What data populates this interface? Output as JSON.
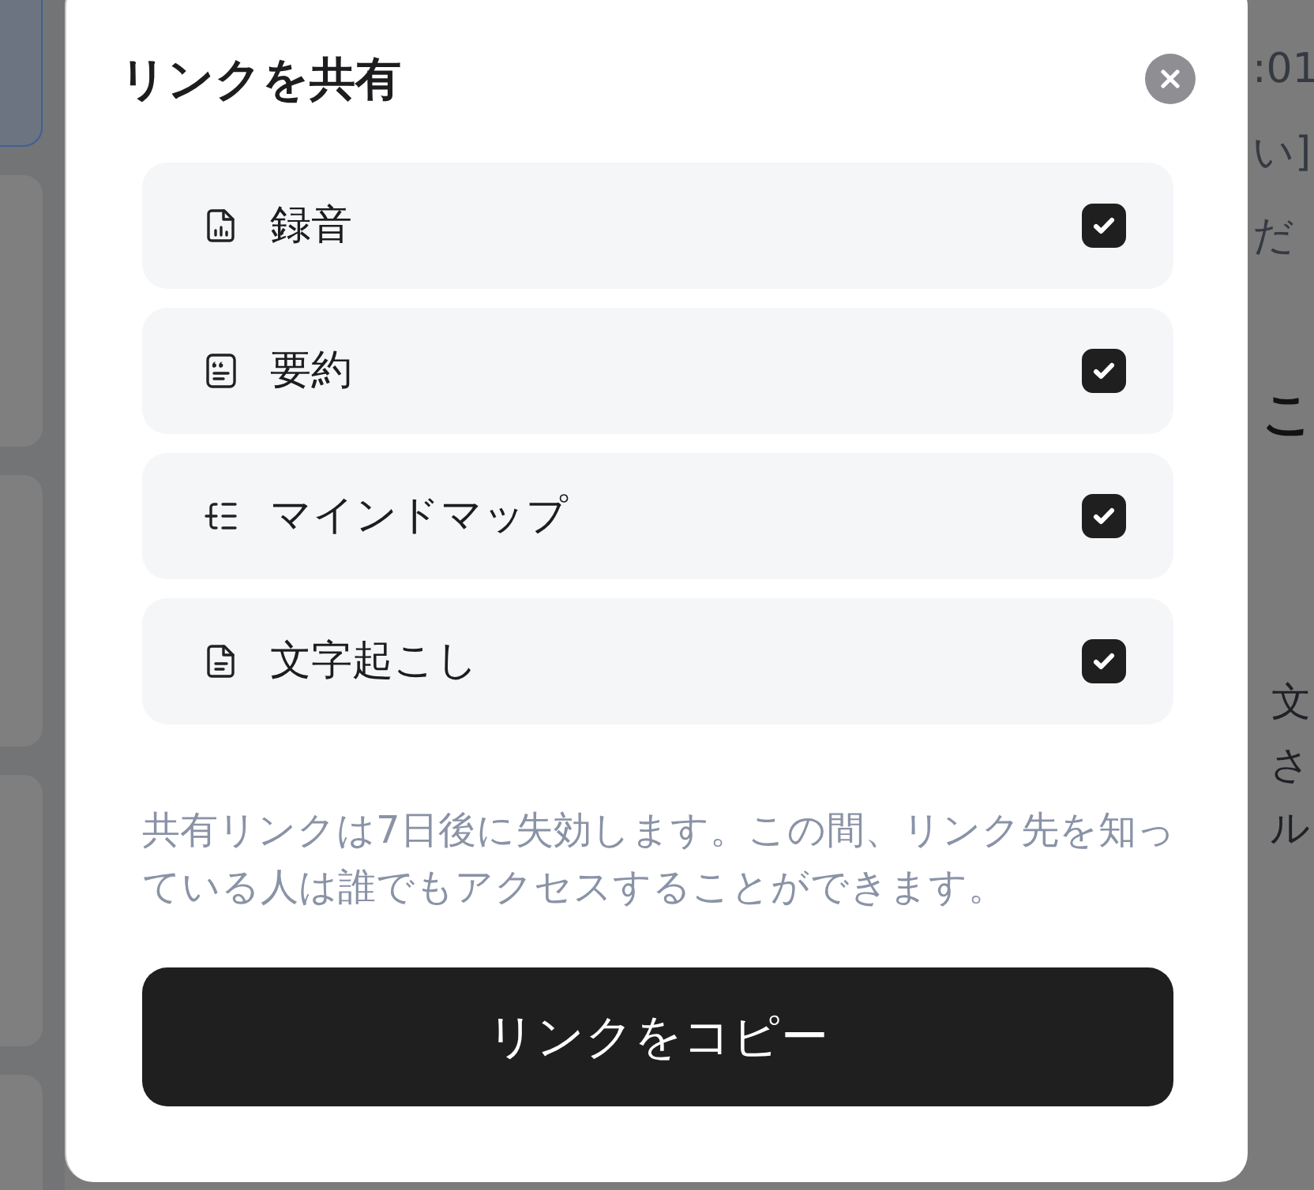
{
  "background": {
    "sidebar_cards": [
      {
        "selected": true
      },
      {
        "selected": false
      },
      {
        "selected": false
      },
      {
        "selected": false
      },
      {
        "selected": false
      }
    ],
    "top_lines": [
      ":01",
      "い]",
      "だ"
    ],
    "heading": "こ",
    "body_lines": [
      "文",
      "さ",
      "ル"
    ]
  },
  "dialog": {
    "title": "リンクを共有",
    "options": [
      {
        "kind": "recording",
        "label": "録音",
        "checked": true
      },
      {
        "kind": "summary",
        "label": "要約",
        "checked": true
      },
      {
        "kind": "mind_map",
        "label": "マインドマップ",
        "checked": true
      },
      {
        "kind": "transcript",
        "label": "文字起こし",
        "checked": true
      }
    ],
    "notice": "共有リンクは7日後に失効します。この間、リンク先を知っている人は誰でもアクセスすることができます。",
    "copy_button": "リンクをコピー"
  }
}
